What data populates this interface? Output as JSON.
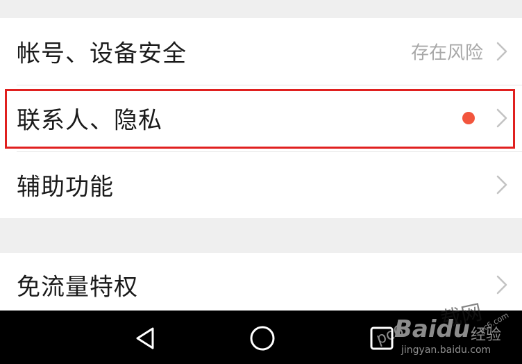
{
  "settings": {
    "items": [
      {
        "label": "帐号、设备安全",
        "value": "存在风险"
      },
      {
        "label": "联系人、隐私",
        "badge_color": "#f2553d"
      },
      {
        "label": "辅助功能"
      },
      {
        "label": "免流量特权"
      }
    ]
  },
  "highlight": {
    "color": "#e0201f"
  },
  "navbar": {
    "buttons": [
      "back-icon",
      "home-icon",
      "recents-icon"
    ]
  },
  "watermark": {
    "brand": "Baidu",
    "brand_cn": "经验",
    "url": "jingyan.baidu.com",
    "site": "pc6",
    "site_cn": "载网",
    "site_url": "pc6.com"
  },
  "colors": {
    "background": "#efefef",
    "row_bg": "#ffffff",
    "text": "#1a1a1a",
    "secondary_text": "#a8a8a8",
    "chevron": "#c2c2c2",
    "navbar": "#000000"
  }
}
